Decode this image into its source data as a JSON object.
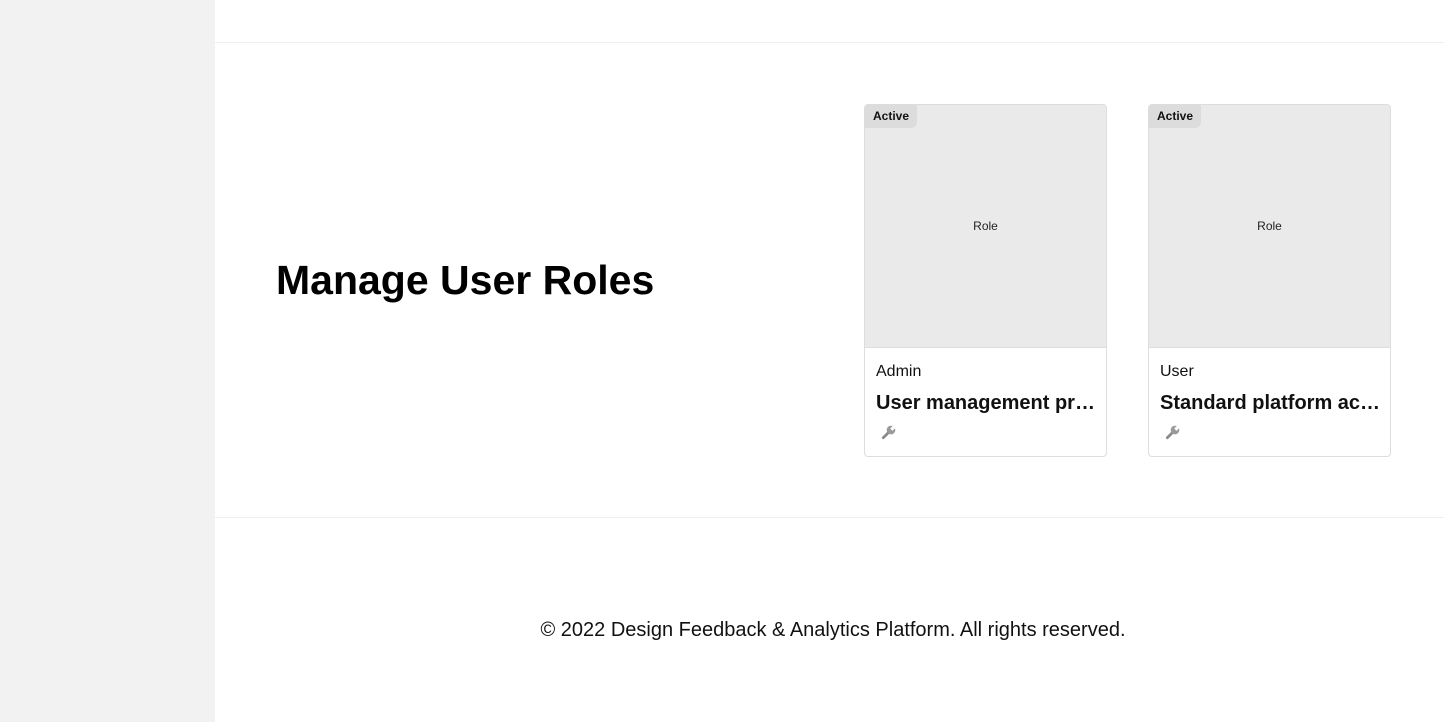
{
  "main": {
    "title": "Manage User Roles"
  },
  "roles": [
    {
      "badge": "Active",
      "image_label": "Role",
      "name": "Admin",
      "description": "User management privileges",
      "action_icon": "wrench-icon"
    },
    {
      "badge": "Active",
      "image_label": "Role",
      "name": "User",
      "description": "Standard platform access",
      "action_icon": "wrench-icon"
    }
  ],
  "footer": {
    "copyright": "© 2022 Design Feedback & Analytics Platform. All rights reserved."
  }
}
